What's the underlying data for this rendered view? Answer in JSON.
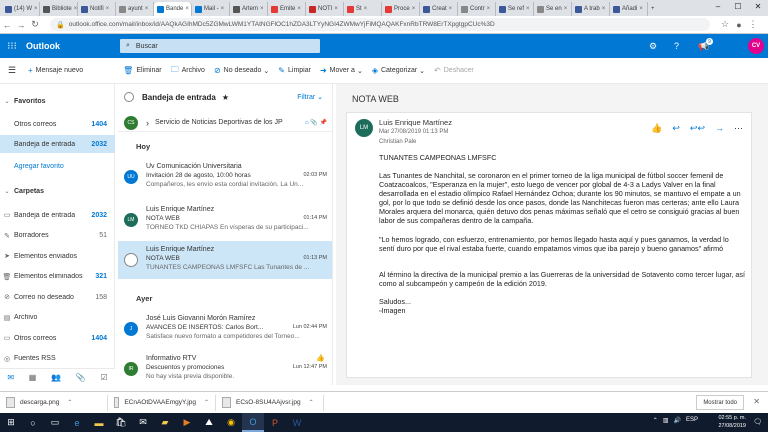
{
  "browser": {
    "tabs": [
      {
        "label": "(14) W",
        "color": "#3b5998"
      },
      {
        "label": "Bibliote",
        "color": "#555"
      },
      {
        "label": "Notifi",
        "color": "#3b5998"
      },
      {
        "label": "ayunt",
        "color": "#888"
      },
      {
        "label": "Bande",
        "color": "#0078d4",
        "active": true
      },
      {
        "label": "Mail -",
        "color": "#0078d4"
      },
      {
        "label": "Artem",
        "color": "#555"
      },
      {
        "label": "Emite",
        "color": "#e53935"
      },
      {
        "label": "NOTI",
        "color": "#c62828"
      },
      {
        "label": "St",
        "color": "#e53935"
      },
      {
        "label": "Proce",
        "color": "#e53935"
      },
      {
        "label": "Creat",
        "color": "#3b5998"
      },
      {
        "label": "Contr",
        "color": "#888"
      },
      {
        "label": "Se ref",
        "color": "#3b5998"
      },
      {
        "label": "Se en",
        "color": "#888"
      },
      {
        "label": "A trab",
        "color": "#3b5998"
      },
      {
        "label": "Añadi",
        "color": "#3b5998"
      }
    ],
    "url": "outlook.office.com/mail/inbox/id/AAQkAGIhMDc5ZGMwLWM1YTAtNGFlOC1hZDA3LTYyNGI4ZWMwYjFiMQAQAKFxnRbTRW8ErTXpgtgpCUc%3D"
  },
  "header": {
    "brand": "Outlook",
    "search_placeholder": "Buscar",
    "badge": "9",
    "avatar": "CV"
  },
  "commands": [
    {
      "icon": "🗑",
      "label": "Eliminar"
    },
    {
      "icon": "🗀",
      "label": "Archivo"
    },
    {
      "icon": "⊘",
      "label": "No deseado",
      "caret": "⌄"
    },
    {
      "icon": "✎",
      "label": "Limpiar"
    },
    {
      "icon": "➜",
      "label": "Mover a",
      "caret": "⌄"
    },
    {
      "icon": "◈",
      "label": "Categorizar",
      "caret": "⌄"
    },
    {
      "icon": "↶",
      "label": "Deshacer",
      "disabled": true
    }
  ],
  "nav": {
    "new_message": "Mensaje nuevo",
    "favoritos": "Favoritos",
    "carpetas": "Carpetas",
    "agregar_favorito": "Agregar favorito",
    "fav_items": [
      {
        "label": "Otros correos",
        "count": "1404"
      },
      {
        "label": "Bandeja de entrada",
        "count": "2032",
        "selected": true
      }
    ],
    "folders": [
      {
        "label": "Bandeja de entrada",
        "count": "2032",
        "bold": true
      },
      {
        "label": "Borradores",
        "count": "51",
        "bold": false
      },
      {
        "label": "Elementos enviados",
        "count": "",
        "bold": false
      },
      {
        "label": "Elementos eliminados",
        "count": "321",
        "bold": true
      },
      {
        "label": "Correo no deseado",
        "count": "158",
        "bold": false
      },
      {
        "label": "Archivo",
        "count": "",
        "bold": false
      },
      {
        "label": "Otros correos",
        "count": "1404",
        "bold": true
      },
      {
        "label": "Fuentes RSS",
        "count": "",
        "bold": false
      }
    ]
  },
  "list": {
    "title": "Bandeja de entrada",
    "filter": "Filtrar",
    "pinned": {
      "avatar": "CS",
      "sender": "Servicio de Noticias Deportivas de los JP",
      "color": "#2e7d32"
    },
    "group_hoy": "Hoy",
    "group_ayer": "Ayer",
    "messages": [
      {
        "avatar": "UU",
        "color": "#0078d4",
        "sender": "Uv Comunicación Universitaria",
        "subject": "Invitación 28 de agosto, 10:00 horas",
        "time": "02:03 PM",
        "preview": "Compañeros, les envío esta cordial invitación. La Un..."
      },
      {
        "avatar": "LM",
        "color": "#1d6d5a",
        "sender": "Luis Enrique Martínez",
        "subject": "NOTA WEB",
        "time": "01:14 PM",
        "preview": "TORNEO TKD CHIAPAS En vísperas de su participaci..."
      },
      {
        "avatar": "",
        "color": "#ffffff",
        "sender": "Luis Enrique Martínez",
        "subject": "NOTA WEB",
        "time": "01:13 PM",
        "preview": "TUNANTES CAMPEONAS LMFSFC Las Tunantes de ...",
        "selected": true
      },
      {
        "avatar": "J",
        "color": "#0078d4",
        "sender": "José Luis Giovanni Morón Ramírez",
        "subject": "AVANCES DE INSERTOS: Carlos Bort...",
        "time": "Lun 02:44 PM",
        "preview": "Satisface nuevo formato a competidores del Torneo..."
      },
      {
        "avatar": "IR",
        "color": "#2e7d32",
        "sender": "Informativo RTV",
        "subject": "Descuentos y promociones",
        "time": "Lun 12:47 PM",
        "preview": "No hay vista previa disponible."
      }
    ]
  },
  "reading": {
    "title": "NOTA WEB",
    "avatar": "LM",
    "from": "Luis Enrique Martínez",
    "date": "Mar 27/08/2019 01:13 PM",
    "to": "Christian Pale",
    "body": {
      "p1": "TUNANTES CAMPEONAS LMFSFC",
      "p2": "Las Tunantes de Nanchital, se coronaron en el primer torneo de la liga municipal de fútbol soccer femenil de Coatzacoalcos, \"Esperanza en la mujer\", esto luego de vencer por global de 4-3 a Ladys Valver en la final desarrollada en el estadio olímpico Rafael Hernández Ochoa; durante los 90 minutos, se mantuvo el empate a un gol, por lo que todo se definió desde los once pasos, donde las Nanchitecas fueron mas certeras; ante ello Laura Morales arquera del monarca, quién detuvo dos penas máximas señaló que el cetro se consiguió gracias al buen labor de sus compañeras dentro de la campaña.",
      "p3": "\"Lo hemos logrado, con esfuerzo, entrenamiento, por hemos llegado hasta aquí y pues ganamos, la verdad lo sentí duro por que el rival estaba fuerte, cuando empatamos vimos que iba parejo y bueno ganamos\" afirmó",
      "p4": "Al término la directiva de la municipal premio a las Guerreras de la universidad de Sotavento como tercer lugar, así como al subcampeón y campeón de la edición 2019.",
      "p5": "Saludos...",
      "img": "Imagen"
    }
  },
  "downloads": {
    "items": [
      "descarga.png",
      "ECnAOtDVAAEmgyY.jpg",
      "ECsO-8SU4AAjvsr.jpg"
    ],
    "show_all": "Mostrar todo"
  },
  "clock": {
    "time": "02:55 p. m.",
    "date": "27/08/2019"
  },
  "tray_lang": "ESP"
}
